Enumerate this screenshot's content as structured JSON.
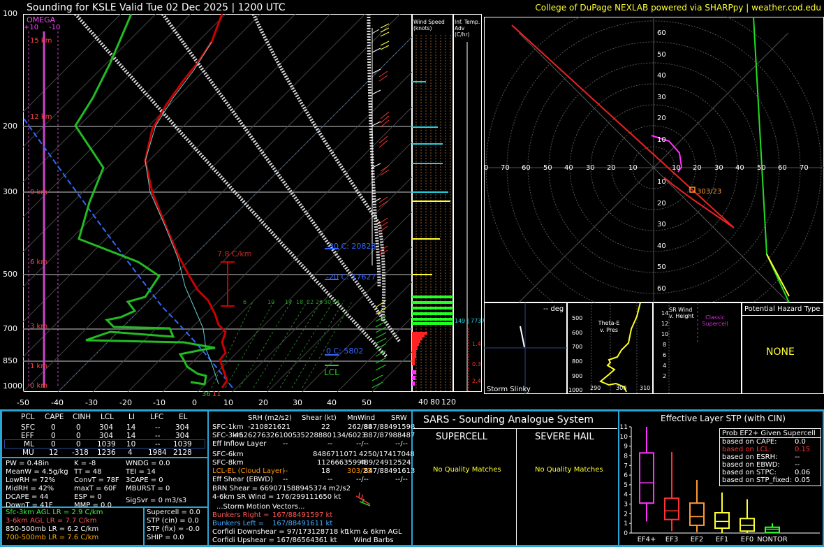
{
  "header": {
    "title": "Sounding for KSLE Valid  Tue 02 Dec 2025 | 1200 UTC",
    "credit": "College of DuPage NEXLAB powered via SHARPpy | weather.cod.edu"
  },
  "skewt": {
    "pressure_labels": [
      "100",
      "200",
      "300",
      "500",
      "700",
      "850",
      "1000"
    ],
    "temp_labels": [
      "-50",
      "-40",
      "-30",
      "-20",
      "-10",
      "0",
      "10",
      "20",
      "30",
      "40",
      "50"
    ],
    "height_labels": [
      "15 km",
      "12 km",
      "9 km",
      "6 km",
      "3 km",
      "1 km",
      "0 km"
    ],
    "omega_title": "OMEGA",
    "omega_scale": [
      "+10",
      "-10"
    ],
    "lapse_label": "7.8 C/km",
    "lcl_label": "LCL",
    "sfc_temp": "36",
    "sfc_marker": "11",
    "level_labels": [
      "-30 C: 20828",
      "-20 C: 17627",
      "0 C: 5802"
    ],
    "mix_labels": [
      "6",
      "10",
      "14",
      "18",
      "22",
      "26",
      "30",
      "34"
    ]
  },
  "panels": {
    "wind_speed_title": "Wind Speed (knots)",
    "wind_speed_ticks": [
      "40",
      "80",
      "120"
    ],
    "inf_temp_title": "Inf. Temp. Adv (C/hr)",
    "inf_ticks": [
      "1.4",
      "0.3",
      "2.4"
    ],
    "wind_speed_label": "149 | 7737"
  },
  "hodograph": {
    "x_labels": [
      "0",
      "70",
      "60",
      "50",
      "40",
      "30",
      "20",
      "10",
      "10",
      "20",
      "30",
      "40",
      "50",
      "60",
      "70"
    ],
    "y_labels_up": [
      "60",
      "50",
      "40",
      "30",
      "20",
      "10"
    ],
    "y_labels_down": [
      "10",
      "20",
      "30",
      "40",
      "50",
      "60"
    ],
    "storm_label": "303/23"
  },
  "slinky": {
    "deg": "-- deg",
    "label": "Storm Slinky"
  },
  "thetae": {
    "title": "Theta-E v. Pres",
    "yticks": [
      "500",
      "600",
      "700",
      "800",
      "900",
      "1000"
    ],
    "xticks": [
      "290",
      "300",
      "310"
    ]
  },
  "srwind": {
    "title": "SR Wind v. Height",
    "classic": "Classic Supercell",
    "yticks": [
      "14",
      "12",
      "10",
      "8",
      "6",
      "4",
      "2"
    ]
  },
  "hazard": {
    "title": "Potential Hazard Type",
    "value": "NONE"
  },
  "parcels": {
    "headers": [
      "PCL",
      "CAPE",
      "CINH",
      "LCL",
      "LI",
      "LFC",
      "EL"
    ],
    "rows": [
      [
        "SFC",
        "0",
        "0",
        "304",
        "14",
        "--",
        "304"
      ],
      [
        "EFF",
        "0",
        "0",
        "304",
        "14",
        "--",
        "304"
      ],
      [
        "ML",
        "0",
        "0",
        "1039",
        "10",
        "--",
        "1039"
      ],
      [
        "MU",
        "12",
        "-318",
        "1236",
        "4",
        "1984",
        "2128"
      ]
    ]
  },
  "indices": {
    "col1": [
      "PW = 0.48in",
      "MeanW = 4.5g/kg",
      "LowRH = 72%",
      "MidRH = 42%",
      "DCAPE = 44",
      "DownT = 41F"
    ],
    "col2": [
      "K = -8",
      "TT = 48",
      "ConvT = 78F",
      "maxT = 60F",
      "ESP = 0",
      "MMP = 0.0"
    ],
    "col3": [
      "WNDG = 0.0",
      "TEI = 14",
      "3CAPE = 0",
      "MBURST = 0",
      "",
      "SigSvr = 0 m3/s3"
    ]
  },
  "lapse_rates": [
    {
      "text": "Sfc-3km AGL LR = 2.9 C/km",
      "color": "#33ff33"
    },
    {
      "text": "3-6km AGL LR = 7.7 C/km",
      "color": "#ff5555"
    },
    {
      "text": "850-500mb LR = 6.2 C/km",
      "color": "#ffffff"
    },
    {
      "text": "700-500mb LR = 7.6 C/km",
      "color": "#ffaa00"
    }
  ],
  "composites": [
    "Supercell = 0.0",
    "STP (cin) = 0.0",
    "STP (fix) = -0.0",
    "SHIP = 0.0"
  ],
  "kinematics": {
    "headers": [
      "SRH (m2/s2)",
      "Shear (kt)",
      "MnWind",
      "SRW"
    ],
    "rows": [
      {
        "label": "SFC-1km",
        "c1": "-210821621",
        "c2": "22",
        "c3": "262/88",
        "c4": "847/88491598",
        "color": "#ffffff"
      },
      {
        "label": "SFC-3km",
        "c1": "45262763261005",
        "c2": "35228880",
        "c3": "134/6023",
        "c4": "887/87988487",
        "color": "#ffffff"
      },
      {
        "label": "Eff Inflow Layer",
        "c1": "--",
        "c2": "--",
        "c3": "--/--",
        "c4": "--/--",
        "color": "#ffffff"
      },
      {
        "label": "SFC-6km",
        "c1": "8486711071",
        "c2": "",
        "c3": "",
        "c4": "4250/17417048",
        "color": "#ffffff"
      },
      {
        "label": "SFC-8km",
        "c1": "11266635994",
        "c2": "",
        "c3": "489/24912524",
        "c4": "",
        "color": "#ffffff"
      },
      {
        "label": "LCL-EL (Cloud Layer)",
        "c1": "--",
        "c2": "18",
        "c3": "303/23",
        "c4": "847/88491613",
        "color": "#ff9900"
      },
      {
        "label": "Eff Shear (EBWD)",
        "c1": "--",
        "c2": "--",
        "c3": "--/--",
        "c4": "--/--",
        "color": "#ffffff"
      }
    ],
    "brn": "BRN Shear = 669071588945374 m2/s2",
    "sr_wind": "4-6km SR Wind = 176/299111650 kt",
    "storm_motion": "...Storm Motion Vectors...",
    "bunkers_right": "Bunkers Right =",
    "bunkers_right_val": "167/88491597 kt",
    "bunkers_left": "Bunkers Left =",
    "bunkers_left_val": "167/88491611 kt",
    "corfidi_down": "Corfidi Downshear = 97/173128718 kt",
    "corfidi_up": "Corfidi Upshear = 167/86564361 kt",
    "barbs_label": "1km & 6km AGL Wind Barbs"
  },
  "sars": {
    "title": "SARS - Sounding Analogue System",
    "supercell": "SUPERCELL",
    "hail": "SEVERE HAIL",
    "supercell_result": "No Quality Matches",
    "hail_result": "No Quality Matches"
  },
  "stp": {
    "title": "Effective Layer STP (with CIN)",
    "prob_title": "Prob EF2+ Given Supercell",
    "probs": [
      {
        "label": "based on CAPE:",
        "value": "0.0",
        "color": "#ffffff"
      },
      {
        "label": "based on LCL:",
        "value": "0.15",
        "color": "#ff3333"
      },
      {
        "label": "based on ESRH:",
        "value": "--",
        "color": "#ffffff"
      },
      {
        "label": "based on EBWD:",
        "value": "--",
        "color": "#ffffff"
      },
      {
        "label": "based on STPC:",
        "value": "0.06",
        "color": "#ffffff"
      },
      {
        "label": "based on STP_fixed:",
        "value": "0.05",
        "color": "#ffffff"
      }
    ],
    "yticks": [
      "11",
      "10",
      "9",
      "8",
      "7",
      "6",
      "5",
      "4",
      "3",
      "2",
      "1",
      "0"
    ],
    "categories": [
      "EF4+",
      "EF3",
      "EF2",
      "EF1",
      "EF0",
      "NONTOR"
    ]
  },
  "chart_data": {
    "type": "box",
    "title": "Effective Layer STP (with CIN)",
    "categories": [
      "EF4+",
      "EF3",
      "EF2",
      "EF1",
      "EF0",
      "NONTOR"
    ],
    "ylim": [
      0,
      11
    ],
    "boxes": [
      {
        "name": "EF4+",
        "min": 1.2,
        "q1": 3.1,
        "median": 5.2,
        "q3": 8.3,
        "max": 11.0,
        "color": "#ff33ff"
      },
      {
        "name": "EF3",
        "min": 0.2,
        "q1": 1.4,
        "median": 2.3,
        "q3": 3.6,
        "max": 8.4,
        "color": "#ff3333"
      },
      {
        "name": "EF2",
        "min": 0.1,
        "q1": 0.8,
        "median": 1.7,
        "q3": 3.1,
        "max": 5.5,
        "color": "#ff9933"
      },
      {
        "name": "EF1",
        "min": 0.0,
        "q1": 0.5,
        "median": 1.2,
        "q3": 2.1,
        "max": 4.2,
        "color": "#ffff33"
      },
      {
        "name": "EF0",
        "min": 0.0,
        "q1": 0.2,
        "median": 0.8,
        "q3": 1.5,
        "max": 3.5,
        "color": "#ffff33"
      },
      {
        "name": "NONTOR",
        "min": 0.0,
        "q1": 0.05,
        "median": 0.4,
        "q3": 0.6,
        "max": 1.0,
        "color": "#33ff33"
      }
    ]
  },
  "colors": {
    "accent": "#2aa6d6",
    "credit": "#ffff33",
    "temp": "#cc0000",
    "dew": "#00cc00",
    "parcel": "#3366ff"
  }
}
